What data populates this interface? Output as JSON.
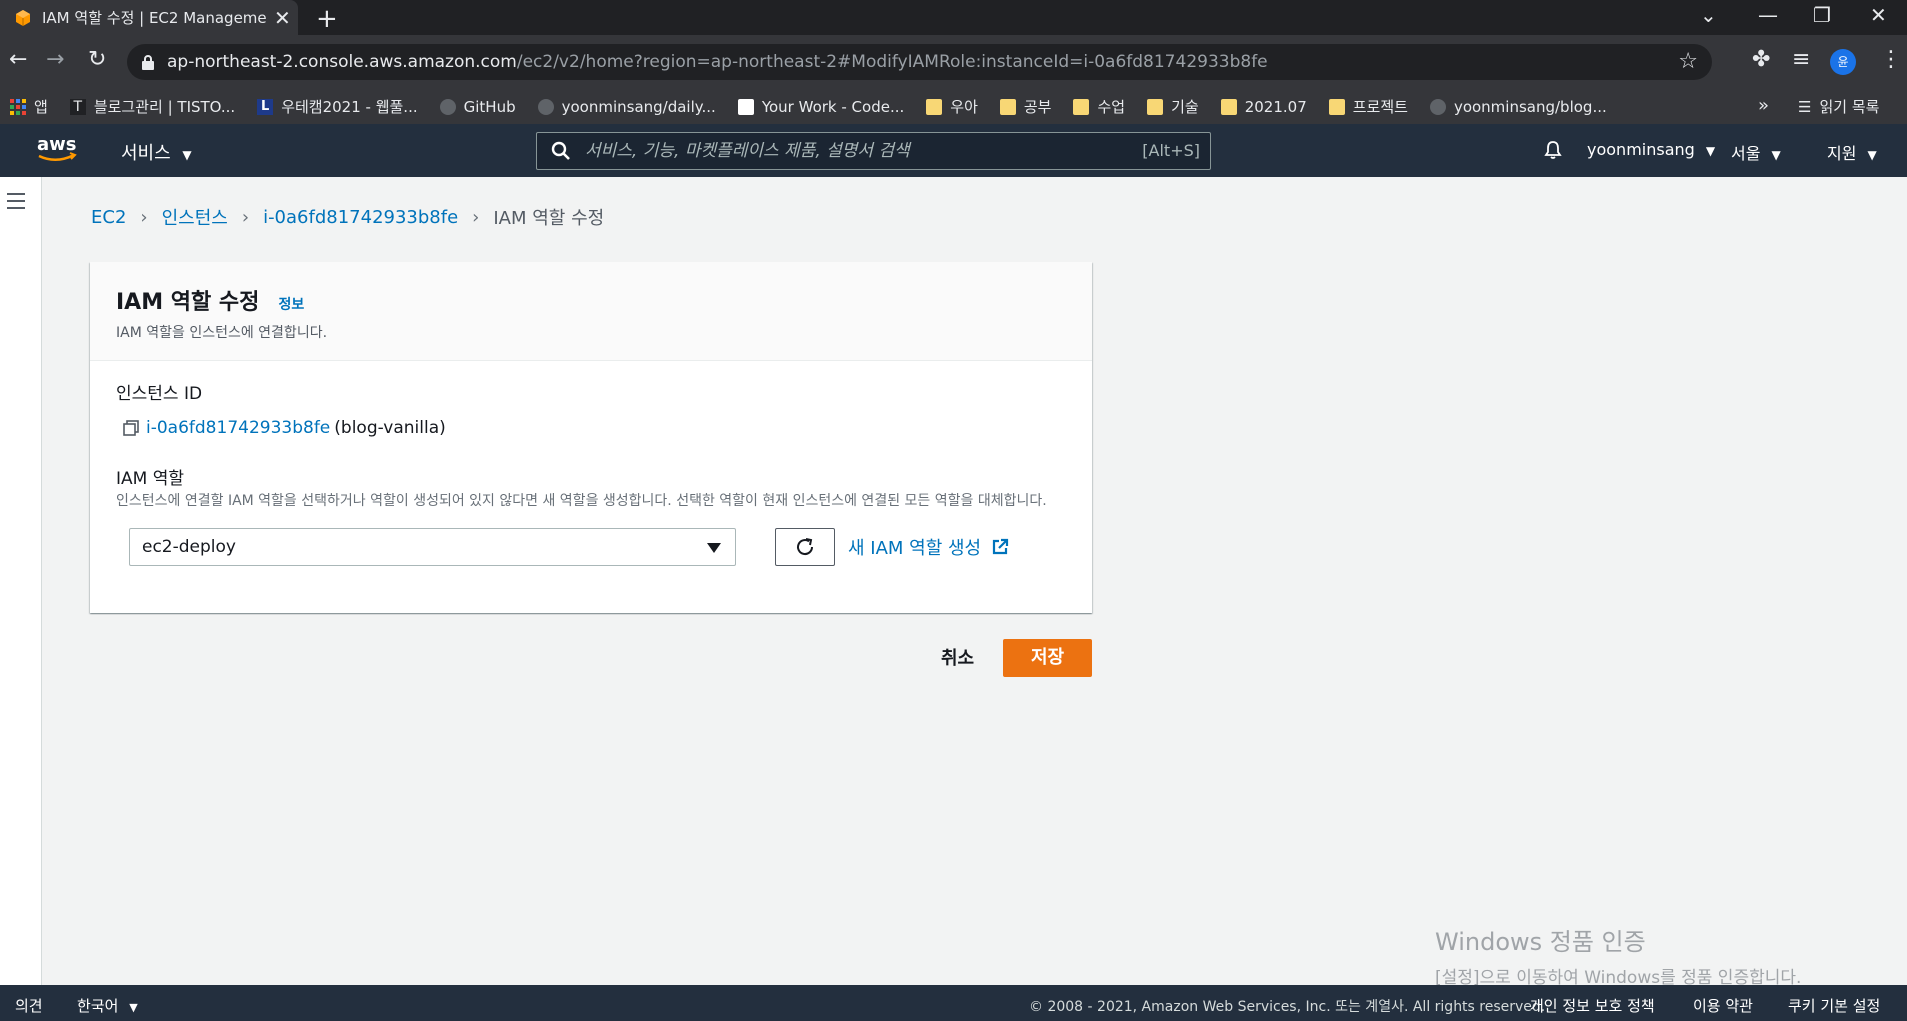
{
  "browser": {
    "tab_title": "IAM 역할 수정 | EC2 Manageme",
    "url_host": "ap-northeast-2.console.aws.amazon.com",
    "url_path": "/ec2/v2/home?region=ap-northeast-2#ModifyIAMRole:instanceId=i-0a6fd81742933b8fe",
    "profile_initial": "윤",
    "bookmarks": [
      {
        "label": "앱",
        "icon": "apps-grid-icon"
      },
      {
        "label": "블로그관리 | TISTO...",
        "icon": "tistory-icon"
      },
      {
        "label": "우테캠2021 - 웹풀...",
        "icon": "l-logo-icon"
      },
      {
        "label": "GitHub",
        "icon": "github-icon"
      },
      {
        "label": "yoonminsang/daily...",
        "icon": "github-icon"
      },
      {
        "label": "Your Work - Code...",
        "icon": "code-icon"
      },
      {
        "label": "우아",
        "icon": "folder-icon"
      },
      {
        "label": "공부",
        "icon": "folder-icon"
      },
      {
        "label": "수업",
        "icon": "folder-icon"
      },
      {
        "label": "기술",
        "icon": "folder-icon"
      },
      {
        "label": "2021.07",
        "icon": "folder-icon"
      },
      {
        "label": "프로젝트",
        "icon": "folder-icon"
      },
      {
        "label": "yoonminsang/blog...",
        "icon": "github-icon"
      }
    ],
    "more_label": "»",
    "reading_list": "읽기 목록"
  },
  "aws_header": {
    "logo": "aws",
    "services": "서비스",
    "search_placeholder": "서비스, 기능, 마켓플레이스 제품, 설명서 검색",
    "search_shortcut": "[Alt+S]",
    "user": "yoonminsang",
    "region": "서울",
    "support": "지원"
  },
  "breadcrumb": {
    "ec2": "EC2",
    "instances": "인스턴스",
    "instance_id": "i-0a6fd81742933b8fe",
    "current": "IAM 역할 수정"
  },
  "panel": {
    "title": "IAM 역할 수정",
    "info": "정보",
    "description": "IAM 역할을 인스턴스에 연결합니다.",
    "instance_label": "인스턴스 ID",
    "instance_id": "i-0a6fd81742933b8fe",
    "instance_name": "(blog-vanilla)",
    "role_label": "IAM 역할",
    "role_description": "인스턴스에 연결할 IAM 역할을 선택하거나 역할이 생성되어 있지 않다면 새 역할을 생성합니다. 선택한 역할이 현재 인스턴스에 연결된 모든 역할을 대체합니다.",
    "selected_role": "ec2-deploy",
    "create_role": "새 IAM 역할 생성"
  },
  "actions": {
    "cancel": "취소",
    "save": "저장"
  },
  "watermark": {
    "line1": "Windows 정품 인증",
    "line2": "[설정]으로 이동하여 Windows를 정품 인증합니다."
  },
  "footer": {
    "feedback": "의견",
    "language": "한국어",
    "copyright": "© 2008 - 2021, Amazon Web Services, Inc. 또는 계열사. All rights reserved.",
    "privacy": "개인 정보 보호 정책",
    "terms": "이용 약관",
    "cookies": "쿠키 기본 설정"
  },
  "colors": {
    "aws_nav": "#232f3e",
    "link": "#0073bb",
    "primary_button": "#ec7211",
    "chrome_dark": "#202124"
  }
}
